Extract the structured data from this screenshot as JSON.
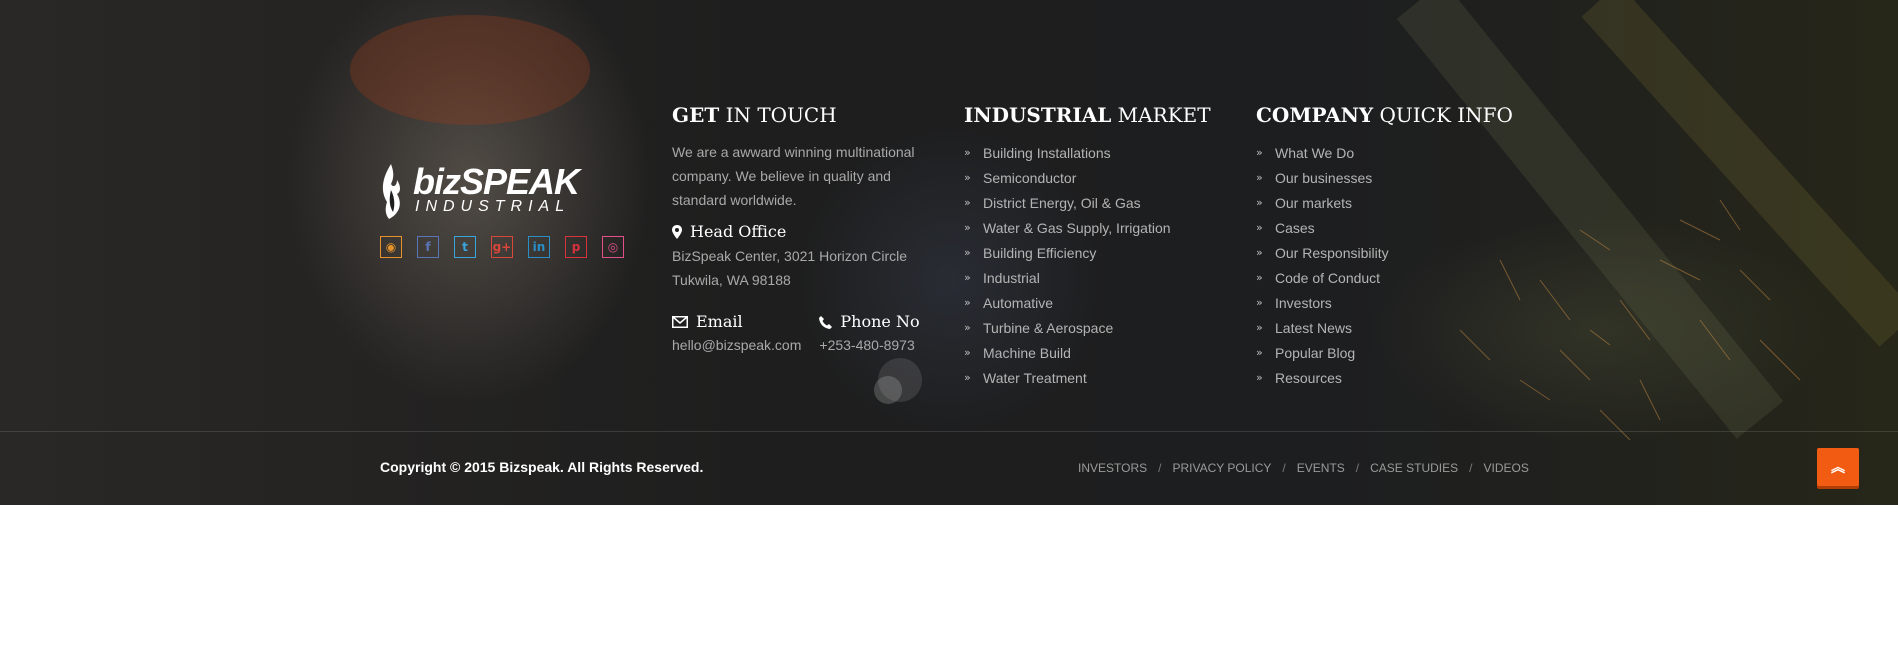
{
  "brand": {
    "name": "bizSPEAK",
    "tagline": "INDUSTRIAL"
  },
  "social": [
    {
      "icon": "rss-icon",
      "glyph": "◉",
      "color": "#e5922b"
    },
    {
      "icon": "facebook-icon",
      "glyph": "f",
      "color": "#5b76b8"
    },
    {
      "icon": "twitter-icon",
      "glyph": "t",
      "color": "#3aa5dd"
    },
    {
      "icon": "google-plus-icon",
      "glyph": "g+",
      "color": "#d9463a"
    },
    {
      "icon": "linkedin-icon",
      "glyph": "in",
      "color": "#2a8fc4"
    },
    {
      "icon": "pinterest-icon",
      "glyph": "p",
      "color": "#d9323f"
    },
    {
      "icon": "dribbble-icon",
      "glyph": "◎",
      "color": "#e2508a"
    }
  ],
  "touch": {
    "title_bold": "GET",
    "title_light": " IN TOUCH",
    "about": "We are a awward winning multinational company. We believe in quality and standard worldwide.",
    "office_label": "Head Office",
    "office_line1": "BizSpeak Center, 3021 Horizon Circle",
    "office_line2": "Tukwila, WA 98188",
    "email_label": "Email",
    "email_value": "hello@bizspeak.com",
    "phone_label": "Phone No",
    "phone_value": "+253-480-8973"
  },
  "market": {
    "title_bold": "INDUSTRIAL",
    "title_light": " MARKET",
    "items": [
      "Building Installations",
      "Semiconductor",
      "District Energy, Oil & Gas",
      "Water & Gas Supply, Irrigation",
      "Building Efficiency",
      "Industrial",
      "Automative",
      "Turbine & Aerospace",
      "Machine Build",
      "Water Treatment"
    ]
  },
  "company": {
    "title_bold": "COMPANY",
    "title_light": " QUICK INFO",
    "items": [
      "What We Do",
      "Our businesses",
      "Our markets",
      "Cases",
      "Our Responsibility",
      "Code of Conduct",
      "Investors",
      "Latest News",
      "Popular Blog",
      "Resources"
    ]
  },
  "bottom": {
    "copyright": "Copyright © 2015 Bizspeak. All Rights Reserved.",
    "links": [
      "INVESTORS",
      "PRIVACY POLICY",
      "EVENTS",
      "CASE STUDIES",
      "VIDEOS"
    ]
  },
  "colors": {
    "accent": "#f25c12",
    "footer_bg": "#1e1e1e"
  }
}
